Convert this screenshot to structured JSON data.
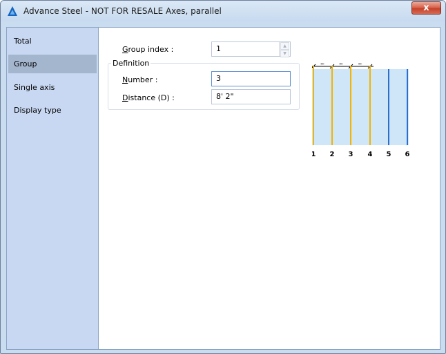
{
  "window": {
    "title": "Advance Steel - NOT FOR RESALE   Axes, parallel",
    "close_glyph": "x"
  },
  "sidebar": {
    "items": [
      {
        "label": "Total",
        "selected": false
      },
      {
        "label": "Group",
        "selected": true
      },
      {
        "label": "Single axis",
        "selected": false
      },
      {
        "label": "Display type",
        "selected": false
      }
    ]
  },
  "form": {
    "group_index": {
      "accel": "G",
      "label_rest": "roup index :",
      "value": "1"
    },
    "definition": {
      "title": "Definition",
      "number": {
        "accel": "N",
        "label_rest": "umber :",
        "value": "3"
      },
      "distance": {
        "accel": "D",
        "label_rest": "istance (D) :",
        "value": "8' 2\""
      }
    }
  },
  "preview": {
    "dimension_label": "D",
    "axis_labels": [
      "1",
      "2",
      "3",
      "4",
      "5",
      "6"
    ],
    "colors": {
      "generated_axis": "#f2b400",
      "existing_axis": "#2a6fc9",
      "band": "#cfe6f8"
    }
  },
  "icons": {
    "app": "advance-steel-logo-icon",
    "close": "close-icon",
    "spin_up": "spin-up-icon",
    "spin_down": "spin-down-icon"
  }
}
